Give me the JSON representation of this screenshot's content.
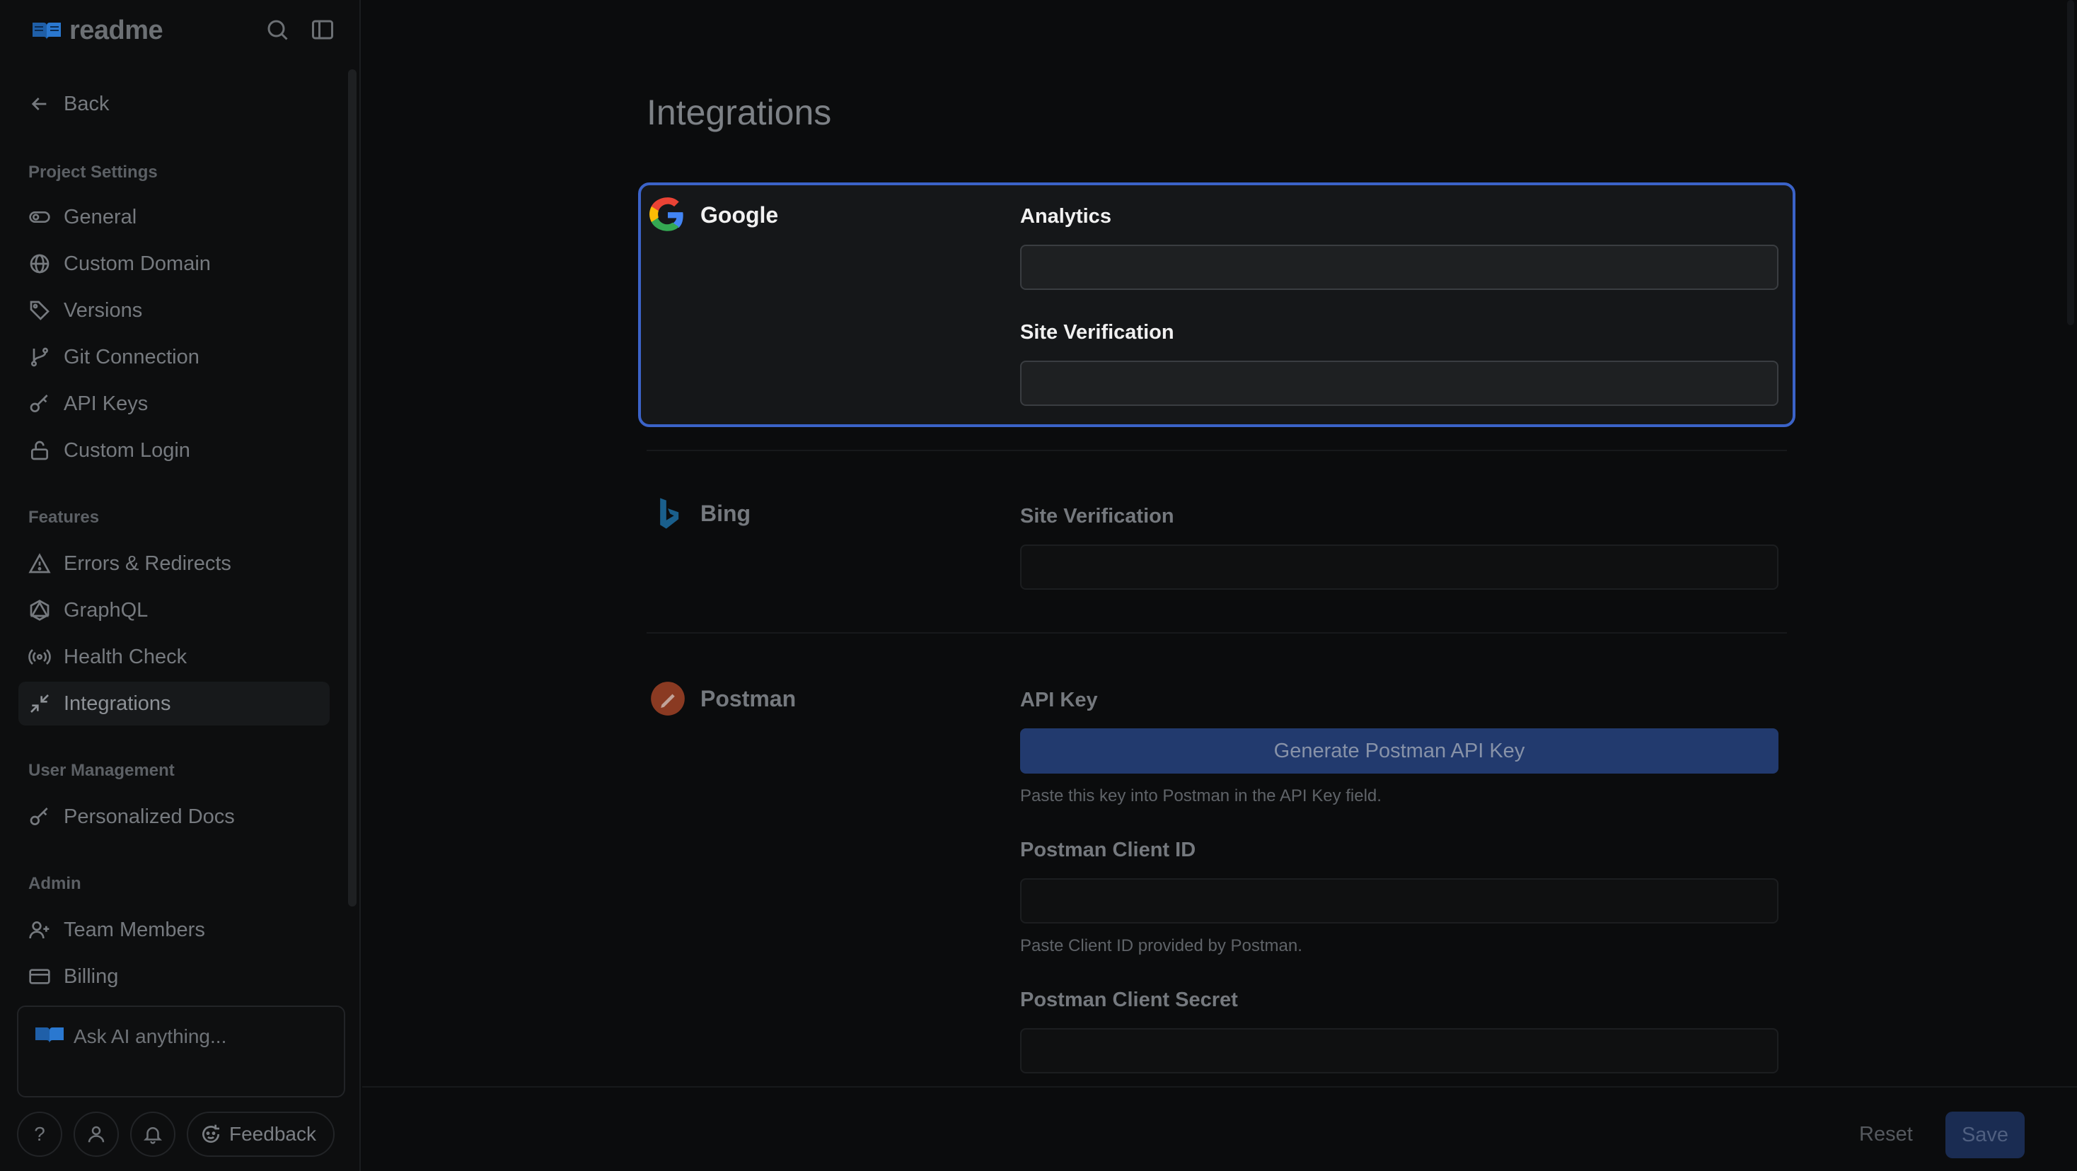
{
  "app": {
    "logo_text": "readme"
  },
  "sidebar": {
    "back_label": "Back",
    "sections": {
      "project": "Project Settings",
      "features": "Features",
      "users": "User Management",
      "admin": "Admin"
    },
    "items": [
      {
        "label": "General"
      },
      {
        "label": "Custom Domain"
      },
      {
        "label": "Versions"
      },
      {
        "label": "Git Connection"
      },
      {
        "label": "API Keys"
      },
      {
        "label": "Custom Login"
      },
      {
        "label": "Errors & Redirects"
      },
      {
        "label": "GraphQL"
      },
      {
        "label": "Health Check"
      },
      {
        "label": "Integrations",
        "active": true
      },
      {
        "label": "Personalized Docs"
      },
      {
        "label": "Team Members"
      },
      {
        "label": "Billing"
      }
    ],
    "ask_placeholder": "Ask AI anything...",
    "help_label": "?",
    "feedback_label": "Feedback"
  },
  "main": {
    "title": "Integrations",
    "google": {
      "name": "Google",
      "analytics_label": "Analytics",
      "analytics_value": "",
      "site_verification_label": "Site Verification",
      "site_verification_value": ""
    },
    "bing": {
      "name": "Bing",
      "site_verification_label": "Site Verification",
      "site_verification_value": ""
    },
    "postman": {
      "name": "Postman",
      "api_key_label": "API Key",
      "generate_button": "Generate Postman API Key",
      "api_key_help": "Paste this key into Postman in the API Key field.",
      "client_id_label": "Postman Client ID",
      "client_id_value": "",
      "client_id_help": "Paste Client ID provided by Postman.",
      "client_secret_label": "Postman Client Secret",
      "client_secret_value": ""
    }
  },
  "footer": {
    "reset_label": "Reset",
    "save_label": "Save"
  },
  "colors": {
    "accent": "#3b63c8",
    "primary_button": "#223a6e",
    "background": "#0b0c0d"
  }
}
